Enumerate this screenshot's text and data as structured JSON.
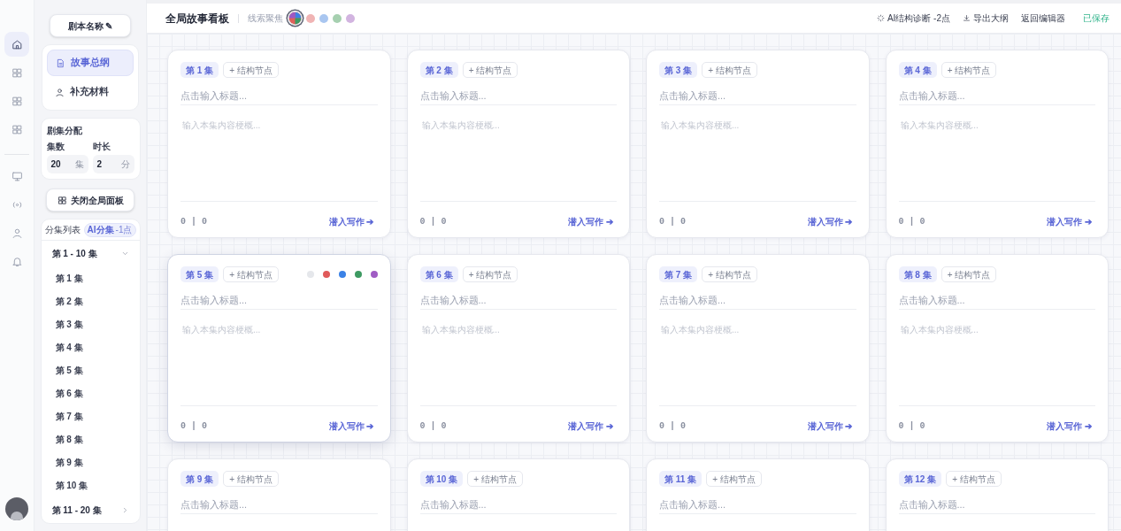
{
  "rail": {
    "items": [
      {
        "kind": "home",
        "selected": true
      },
      {
        "kind": "grid",
        "selected": false
      },
      {
        "kind": "grid",
        "selected": false
      },
      {
        "kind": "grid",
        "selected": false
      },
      {
        "kind": "monitor",
        "selected": false
      },
      {
        "kind": "broadcast",
        "selected": false
      },
      {
        "kind": "user",
        "selected": false
      },
      {
        "kind": "bell",
        "selected": false
      }
    ]
  },
  "sidebar": {
    "script_name": "剧本名称 ✎",
    "nav": [
      {
        "kind": "doc",
        "label": "故事总纲",
        "selected": true
      },
      {
        "kind": "person",
        "label": "补充材料",
        "selected": false
      }
    ],
    "allocation": {
      "title": "剧集分配",
      "fields": [
        {
          "label": "集数",
          "value": "20",
          "unit": "集"
        },
        {
          "label": "时长",
          "value": "2",
          "unit": "分"
        }
      ]
    },
    "panel_button": "关闭全局面板",
    "episode_list": {
      "title": "分集列表",
      "ai_button": "AI分集",
      "ai_cost": "-1点",
      "groups": [
        {
          "label": "第 1 - 10 集",
          "expanded": true,
          "children": [
            {
              "label": "第 1 集"
            },
            {
              "label": "第 2 集"
            },
            {
              "label": "第 3 集"
            },
            {
              "label": "第 4 集"
            },
            {
              "label": "第 5 集"
            },
            {
              "label": "第 6 集"
            },
            {
              "label": "第 7 集"
            },
            {
              "label": "第 8 集"
            },
            {
              "label": "第 9 集"
            },
            {
              "label": "第 10 集"
            }
          ]
        },
        {
          "label": "第 11 - 20 集",
          "expanded": false
        }
      ]
    }
  },
  "header": {
    "title": "全局故事看板",
    "threads_label": "线索聚焦",
    "threads": [
      {
        "kind": "all",
        "selected": true
      },
      {
        "kind": "color",
        "color": "#f0b4b4",
        "selected": false
      },
      {
        "kind": "color",
        "color": "#a9c6f0",
        "selected": false
      },
      {
        "kind": "color",
        "color": "#a6d0b0",
        "selected": false
      },
      {
        "kind": "color",
        "color": "#d2b4e0",
        "selected": false
      }
    ],
    "actions": [
      {
        "kind": "diagnose",
        "label": "AI结构诊断 -2点"
      },
      {
        "kind": "export",
        "label": "导出大纲"
      },
      {
        "kind": "plain",
        "label": "返回编辑器"
      }
    ],
    "status": "已保存"
  },
  "cards": [
    {
      "episode": "第 1 集",
      "node_button": "+ 结构节点",
      "title_placeholder": "点击输入标题...",
      "summary_placeholder": "输入本集内容梗概...",
      "stats": "0 | 0",
      "link": "潜入写作 ➔",
      "hovered": false
    },
    {
      "episode": "第 2 集",
      "node_button": "+ 结构节点",
      "title_placeholder": "点击输入标题...",
      "summary_placeholder": "输入本集内容梗概...",
      "stats": "0 | 0",
      "link": "潜入写作 ➔",
      "hovered": false
    },
    {
      "episode": "第 3 集",
      "node_button": "+ 结构节点",
      "title_placeholder": "点击输入标题...",
      "summary_placeholder": "输入本集内容梗概...",
      "stats": "0 | 0",
      "link": "潜入写作 ➔",
      "hovered": false
    },
    {
      "episode": "第 4 集",
      "node_button": "+ 结构节点",
      "title_placeholder": "点击输入标题...",
      "summary_placeholder": "输入本集内容梗概...",
      "stats": "0 | 0",
      "link": "潜入写作 ➔",
      "hovered": false
    },
    {
      "episode": "第 5 集",
      "node_button": "+ 结构节点",
      "title_placeholder": "点击输入标题...",
      "summary_placeholder": "输入本集内容梗概...",
      "stats": "0 | 0",
      "link": "潜入写作 ➔",
      "hovered": true,
      "thread_dots": [
        {
          "color": "#e5e7eb"
        },
        {
          "color": "#e05a5a"
        },
        {
          "color": "#3b82e6"
        },
        {
          "color": "#3e9a62"
        },
        {
          "color": "#a05cc4"
        }
      ]
    },
    {
      "episode": "第 6 集",
      "node_button": "+ 结构节点",
      "title_placeholder": "点击输入标题...",
      "summary_placeholder": "输入本集内容梗概...",
      "stats": "0 | 0",
      "link": "潜入写作 ➔",
      "hovered": false
    },
    {
      "episode": "第 7 集",
      "node_button": "+ 结构节点",
      "title_placeholder": "点击输入标题...",
      "summary_placeholder": "输入本集内容梗概...",
      "stats": "0 | 0",
      "link": "潜入写作 ➔",
      "hovered": false
    },
    {
      "episode": "第 8 集",
      "node_button": "+ 结构节点",
      "title_placeholder": "点击输入标题...",
      "summary_placeholder": "输入本集内容梗概...",
      "stats": "0 | 0",
      "link": "潜入写作 ➔",
      "hovered": false
    },
    {
      "episode": "第 9 集",
      "node_button": "+ 结构节点",
      "title_placeholder": "点击输入标题...",
      "hovered": false
    },
    {
      "episode": "第 10 集",
      "node_button": "+ 结构节点",
      "title_placeholder": "点击输入标题...",
      "hovered": false
    },
    {
      "episode": "第 11 集",
      "node_button": "+ 结构节点",
      "title_placeholder": "点击输入标题...",
      "hovered": false
    },
    {
      "episode": "第 12 集",
      "node_button": "+ 结构节点",
      "title_placeholder": "点击输入标题...",
      "hovered": false
    }
  ]
}
